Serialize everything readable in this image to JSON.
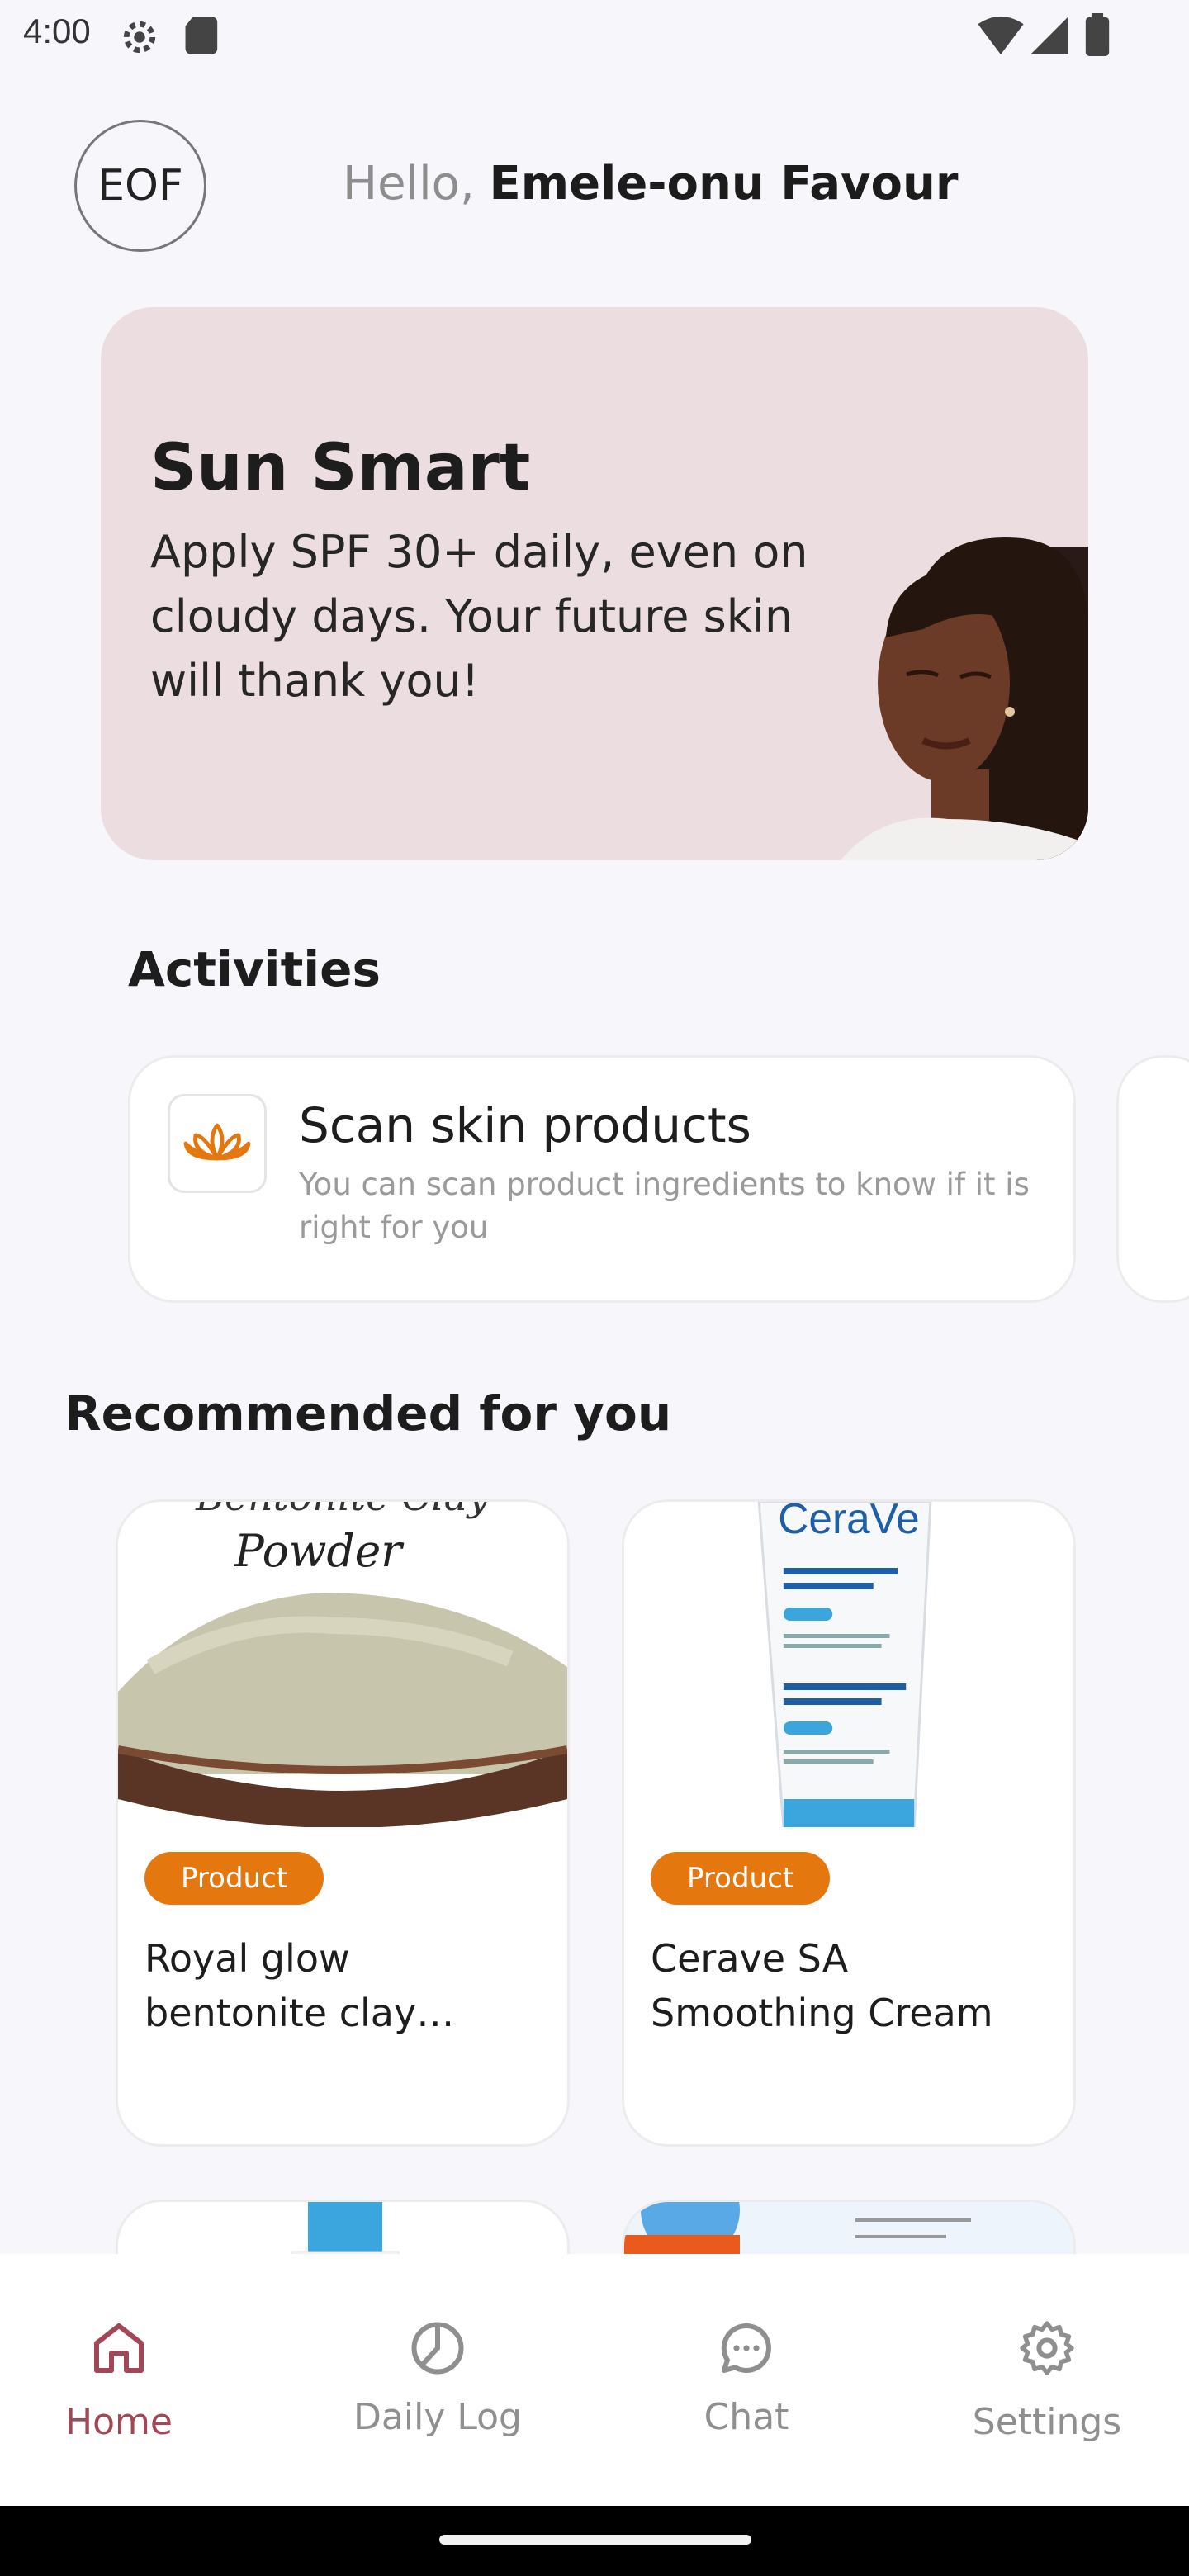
{
  "status_bar": {
    "time": "4:00"
  },
  "header": {
    "avatar_initials": "EOF",
    "greeting_prefix": "Hello, ",
    "user_name": "Emele-onu Favour"
  },
  "tip_card": {
    "title": "Sun Smart",
    "body": "Apply SPF 30+ daily, even on cloudy days. Your future skin will thank you!"
  },
  "activities": {
    "section_title": "Activities",
    "items": [
      {
        "title": "Scan skin products",
        "description": "You can scan product ingredients to know if it is right for you",
        "icon": "lotus-icon"
      }
    ]
  },
  "recommended": {
    "section_title": "Recommended for you",
    "products": [
      {
        "badge": "Product",
        "name": "Royal glow bentonite clay powder",
        "image_caption": "Powder"
      },
      {
        "badge": "Product",
        "name": "Cerave SA Smoothing Cream",
        "image_brand": "CeraVe"
      }
    ]
  },
  "bottom_nav": {
    "items": [
      {
        "label": "Home",
        "icon": "home-icon",
        "active": true
      },
      {
        "label": "Daily Log",
        "icon": "chart-pie-icon",
        "active": false
      },
      {
        "label": "Chat",
        "icon": "chat-bubble-icon",
        "active": false
      },
      {
        "label": "Settings",
        "icon": "gear-icon",
        "active": false
      }
    ]
  },
  "colors": {
    "accent": "#a34756",
    "badge": "#e4780f",
    "tip_card_bg": "#ecdde1",
    "background": "#f7f6fb"
  }
}
